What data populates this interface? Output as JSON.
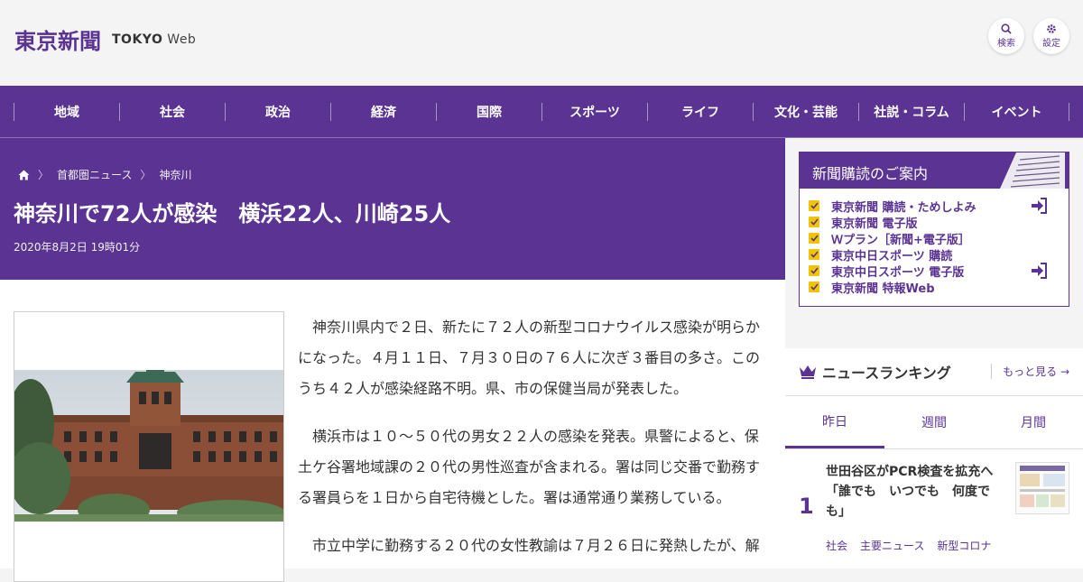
{
  "header": {
    "logo_jp": "東京新聞",
    "logo_en_bold": "TOKYO",
    "logo_en_light": "Web",
    "search_label": "検索",
    "settings_label": "設定"
  },
  "nav": [
    "地域",
    "社会",
    "政治",
    "経済",
    "国際",
    "スポーツ",
    "ライフ",
    "文化・芸能",
    "社説・コラム",
    "イベント"
  ],
  "breadcrumb": [
    "首都圏ニュース",
    "神奈川"
  ],
  "article": {
    "headline": "神奈川で72人が感染　横浜22人、川崎25人",
    "date": "2020年8月2日 19時01分",
    "paragraphs": [
      "神奈川県内で２日、新たに７２人の新型コロナウイルス感染が明らかになった。４月１１日、７月３０日の７６人に次ぎ３番目の多さ。このうち４２人が感染経路不明。県、市の保健当局が発表した。",
      "横浜市は１０～５０代の男女２２人の感染を発表。県警によると、保土ケ谷署地域課の２０代の男性巡査が含まれる。署は同じ交番で勤務する署員らを１日から自宅待機とした。署は通常通り業務している。",
      "市立中学に勤務する２０代の女性教諭は７月２６日に発熱したが、解"
    ]
  },
  "subscription": {
    "title": "新聞購読のご案内",
    "items": [
      {
        "label": "東京新聞 購読・ためしよみ",
        "arrow": true
      },
      {
        "label": "東京新聞 電子版",
        "arrow": false
      },
      {
        "label": "Ｗプラン［新聞+電子版］",
        "arrow": false
      },
      {
        "label": "東京中日スポーツ 購読",
        "arrow": false
      },
      {
        "label": "東京中日スポーツ 電子版",
        "arrow": true
      },
      {
        "label": "東京新聞 特報Web",
        "arrow": false
      }
    ]
  },
  "ranking": {
    "title": "ニュースランキング",
    "more": "もっと見る",
    "tabs": [
      "昨日",
      "週間",
      "月間"
    ],
    "active_tab": "昨日",
    "top_item": {
      "rank": "1",
      "title": "世田谷区がPCR検査を拡充へ「誰でも　いつでも　何度でも」",
      "tags": [
        "社会",
        "主要ニュース",
        "新型コロナ"
      ]
    }
  },
  "colors": {
    "brand": "#5b3393",
    "accent_yellow": "#f1c400"
  },
  "icons": [
    "home-icon",
    "search-icon",
    "gear-icon",
    "crown-icon",
    "login-arrow-icon",
    "check-icon"
  ]
}
